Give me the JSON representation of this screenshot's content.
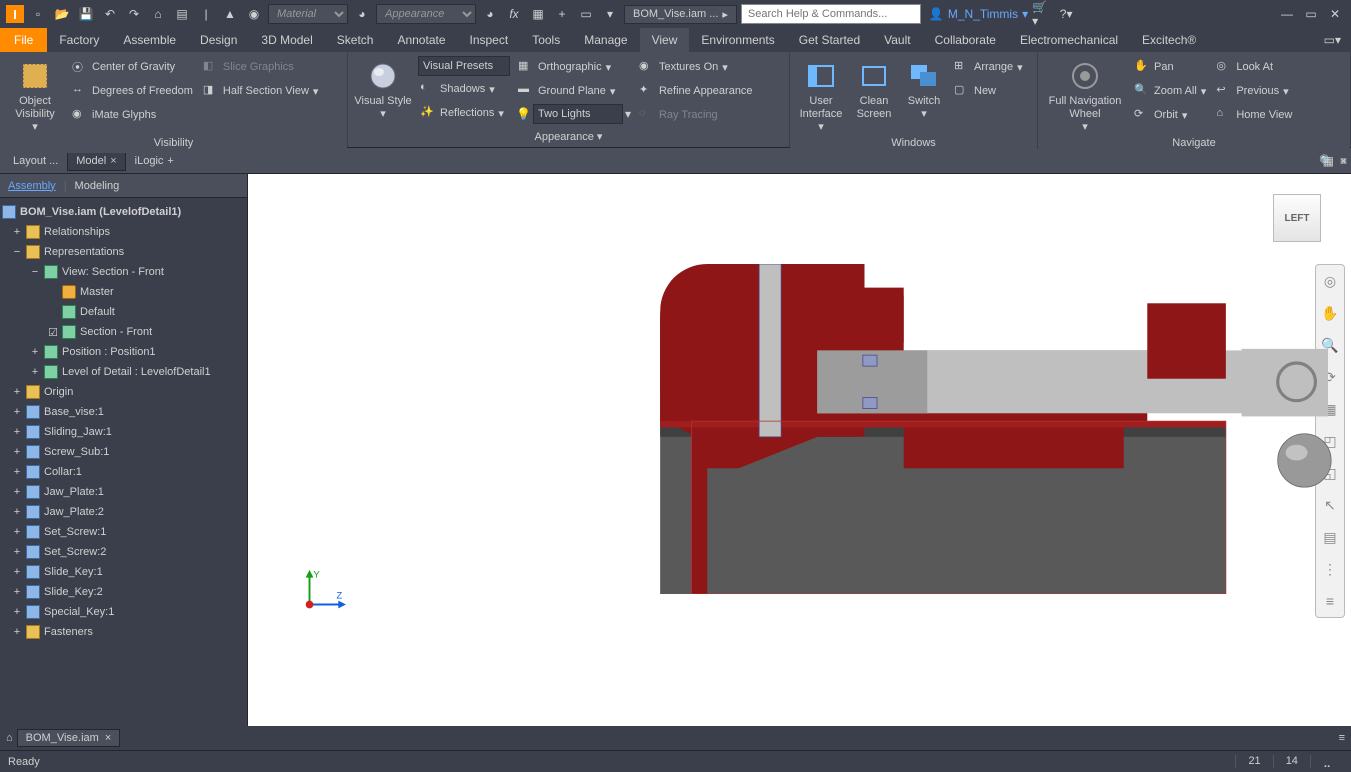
{
  "title_file": "BOM_Vise.iam ...",
  "search_placeholder": "Search Help & Commands...",
  "user_name": "M_N_Timmis",
  "materials_placeholder": "Material",
  "appearance_placeholder": "Appearance",
  "menu": {
    "file": "File",
    "tabs": [
      "Factory",
      "Assemble",
      "Design",
      "3D Model",
      "Sketch",
      "Annotate",
      "Inspect",
      "Tools",
      "Manage",
      "View",
      "Environments",
      "Get Started",
      "Vault",
      "Collaborate",
      "Electromechanical",
      "Excitech®"
    ],
    "active": "View"
  },
  "ribbon": {
    "visibility": {
      "label": "Visibility",
      "object_visibility": "Object Visibility",
      "cog": "Center of Gravity",
      "dof": "Degrees of Freedom",
      "imate": "iMate Glyphs",
      "slice": "Slice Graphics",
      "half_section": "Half Section View"
    },
    "appearance": {
      "label": "Appearance ▾",
      "visual_style": "Visual Style",
      "visual_presets": "Visual Presets",
      "shadows": "Shadows",
      "reflections": "Reflections",
      "orthographic": "Orthographic",
      "ground_plane": "Ground Plane",
      "two_lights": "Two Lights",
      "textures_on": "Textures On",
      "refine": "Refine Appearance",
      "ray_tracing": "Ray Tracing"
    },
    "windows": {
      "label": "Windows",
      "ui": "User Interface",
      "clean": "Clean Screen",
      "switch": "Switch",
      "arrange": "Arrange",
      "new": "New"
    },
    "navigate": {
      "label": "Navigate",
      "wheel": "Full Navigation Wheel",
      "pan": "Pan",
      "zoom_all": "Zoom All",
      "orbit": "Orbit",
      "look_at": "Look At",
      "previous": "Previous",
      "home": "Home View"
    }
  },
  "panel_tabs": {
    "layout": "Layout ...",
    "model": "Model",
    "ilogic": "iLogic"
  },
  "browser": {
    "tabs": {
      "assembly": "Assembly",
      "modeling": "Modeling"
    },
    "root": "BOM_Vise.iam (LevelofDetail1)",
    "relationships": "Relationships",
    "representations": "Representations",
    "view_rep": "View: Section - Front",
    "master": "Master",
    "default": "Default",
    "section_front": "Section - Front",
    "position": "Position : Position1",
    "lod": "Level of Detail : LevelofDetail1",
    "origin": "Origin",
    "parts": [
      "Base_vise:1",
      "Sliding_Jaw:1",
      "Screw_Sub:1",
      "Collar:1",
      "Jaw_Plate:1",
      "Jaw_Plate:2",
      "Set_Screw:1",
      "Set_Screw:2",
      "Slide_Key:1",
      "Slide_Key:2",
      "Special_Key:1"
    ],
    "fasteners": "Fasteners"
  },
  "viewport": {
    "cube_face": "LEFT",
    "axis_y": "Y",
    "axis_z": "Z"
  },
  "doc_tab": "BOM_Vise.iam",
  "status": {
    "ready": "Ready",
    "num1": "21",
    "num2": "14"
  }
}
